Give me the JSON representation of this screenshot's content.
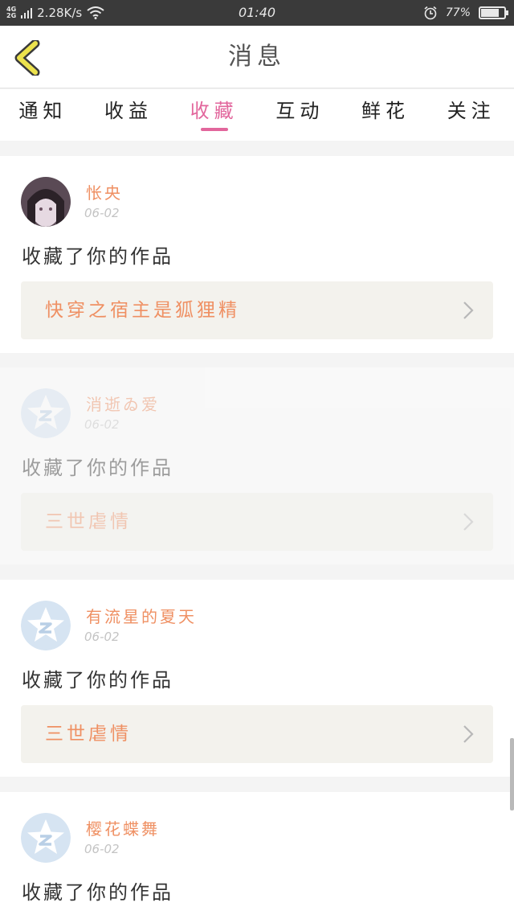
{
  "status_bar": {
    "network_top": "4G",
    "network_bottom": "2G",
    "speed": "2.28K/s",
    "time": "01:40",
    "battery_pct": "77%",
    "battery_level": 0.77
  },
  "header": {
    "title": "消息"
  },
  "tabs": [
    {
      "label": "通知"
    },
    {
      "label": "收益"
    },
    {
      "label": "收藏"
    },
    {
      "label": "互动"
    },
    {
      "label": "鲜花"
    },
    {
      "label": "关注"
    }
  ],
  "messages": [
    {
      "name": "怅央",
      "date": "06-02",
      "action": "收藏了你的作品",
      "work": "快穿之宿主是狐狸精"
    },
    {
      "name": "消逝ゐ爱",
      "date": "06-02",
      "action": "收藏了你的作品",
      "work": "三世虐情"
    },
    {
      "name": "有流星的夏天",
      "date": "06-02",
      "action": "收藏了你的作品",
      "work": "三世虐情"
    },
    {
      "name": "樱花蝶舞",
      "date": "06-02",
      "action": "收藏了你的作品",
      "work": ""
    }
  ],
  "colors": {
    "accent": "#e2669c",
    "name": "#ef9063",
    "card_bg": "#f3f2ed"
  },
  "icons": [
    "back-chevron-icon",
    "wifi-icon",
    "alarm-icon",
    "battery-icon",
    "default-avatar-star-icon",
    "chevron-right-icon"
  ]
}
